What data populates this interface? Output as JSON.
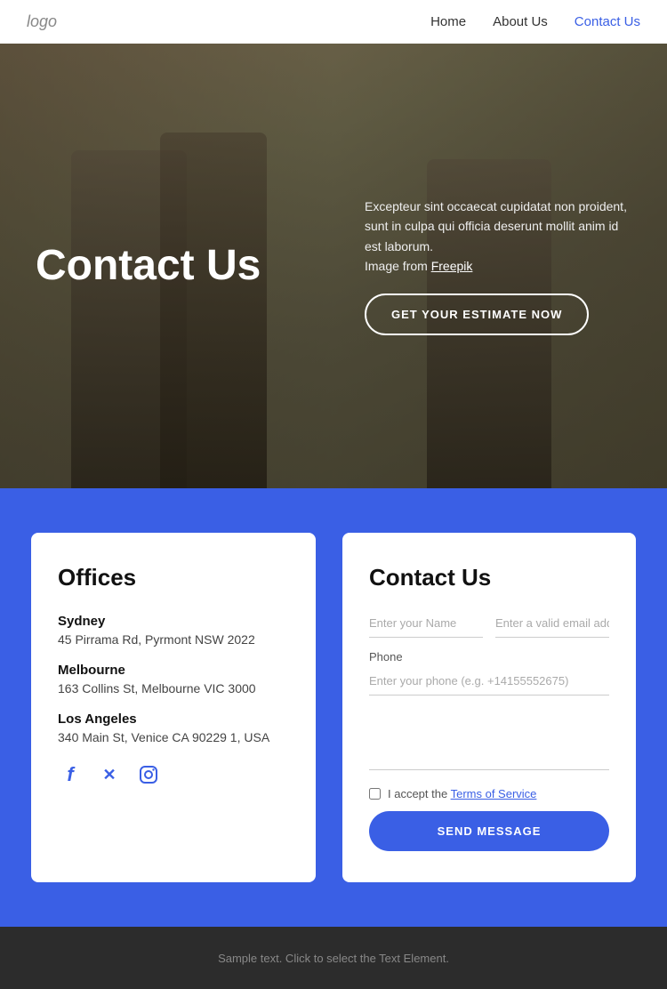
{
  "nav": {
    "logo": "logo",
    "links": [
      {
        "label": "Home",
        "active": false
      },
      {
        "label": "About Us",
        "active": false
      },
      {
        "label": "Contact Us",
        "active": true
      }
    ]
  },
  "hero": {
    "title": "Contact Us",
    "description": "Excepteur sint occaecat cupidatat non proident, sunt in culpa qui officia deserunt mollit anim id est laborum.",
    "image_credit_prefix": "Image from ",
    "image_credit_link": "Freepik",
    "cta_button": "GET YOUR ESTIMATE NOW"
  },
  "offices": {
    "title": "Offices",
    "locations": [
      {
        "name": "Sydney",
        "address": "45 Pirrama Rd, Pyrmont NSW 2022"
      },
      {
        "name": "Melbourne",
        "address": "163 Collins St, Melbourne VIC 3000"
      },
      {
        "name": "Los Angeles",
        "address": "340 Main St, Venice CA 90229 1, USA"
      }
    ],
    "social": [
      {
        "name": "facebook",
        "icon": "f"
      },
      {
        "name": "twitter-x",
        "icon": "𝕏"
      },
      {
        "name": "instagram",
        "icon": "⬡"
      }
    ]
  },
  "contact_form": {
    "title": "Contact Us",
    "name_placeholder": "Enter your Name",
    "email_placeholder": "Enter a valid email address",
    "phone_label": "Phone",
    "phone_placeholder": "Enter your phone (e.g. +14155552675)",
    "message_placeholder": "",
    "checkbox_text": "I accept the ",
    "terms_link": "Terms of Service",
    "submit_button": "SEND MESSAGE"
  },
  "footer": {
    "text": "Sample text. Click to select the Text Element."
  },
  "colors": {
    "accent": "#3a5fe5",
    "hero_overlay": "rgba(0,0,0,0.5)",
    "footer_bg": "#2c2c2c"
  }
}
